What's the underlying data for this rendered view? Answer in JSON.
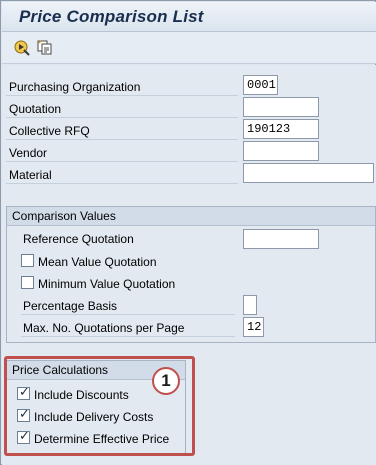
{
  "window": {
    "title": "Price Comparison List"
  },
  "toolbar": {
    "execute_icon": "execute-icon",
    "variant_icon": "get-variant-icon"
  },
  "selection": {
    "purchasing_org_label": "Purchasing Organization",
    "purchasing_org_value": "0001",
    "quotation_label": "Quotation",
    "quotation_value": "",
    "collective_rfq_label": "Collective RFQ",
    "collective_rfq_value": "190123",
    "vendor_label": "Vendor",
    "vendor_value": "",
    "material_label": "Material",
    "material_value": ""
  },
  "comparison_values": {
    "title": "Comparison Values",
    "reference_quotation_label": "Reference Quotation",
    "reference_quotation_value": "",
    "mean_value_label": "Mean Value Quotation",
    "mean_value_checked": false,
    "minimum_value_label": "Minimum Value Quotation",
    "minimum_value_checked": false,
    "percentage_basis_label": "Percentage Basis",
    "percentage_basis_value": "",
    "max_quotations_label": "Max. No. Quotations per Page",
    "max_quotations_value": "12"
  },
  "price_calculations": {
    "title": "Price Calculations",
    "include_discounts_label": "Include Discounts",
    "include_discounts_checked": true,
    "include_delivery_label": "Include Delivery Costs",
    "include_delivery_checked": true,
    "effective_price_label": "Determine Effective Price",
    "effective_price_checked": true
  },
  "annotation": {
    "step_number": "1",
    "highlight_color": "#c0504d"
  },
  "colors": {
    "title_text": "#1a2f4f",
    "background": "#dfe6ef",
    "group_header": "#d2dce8"
  }
}
